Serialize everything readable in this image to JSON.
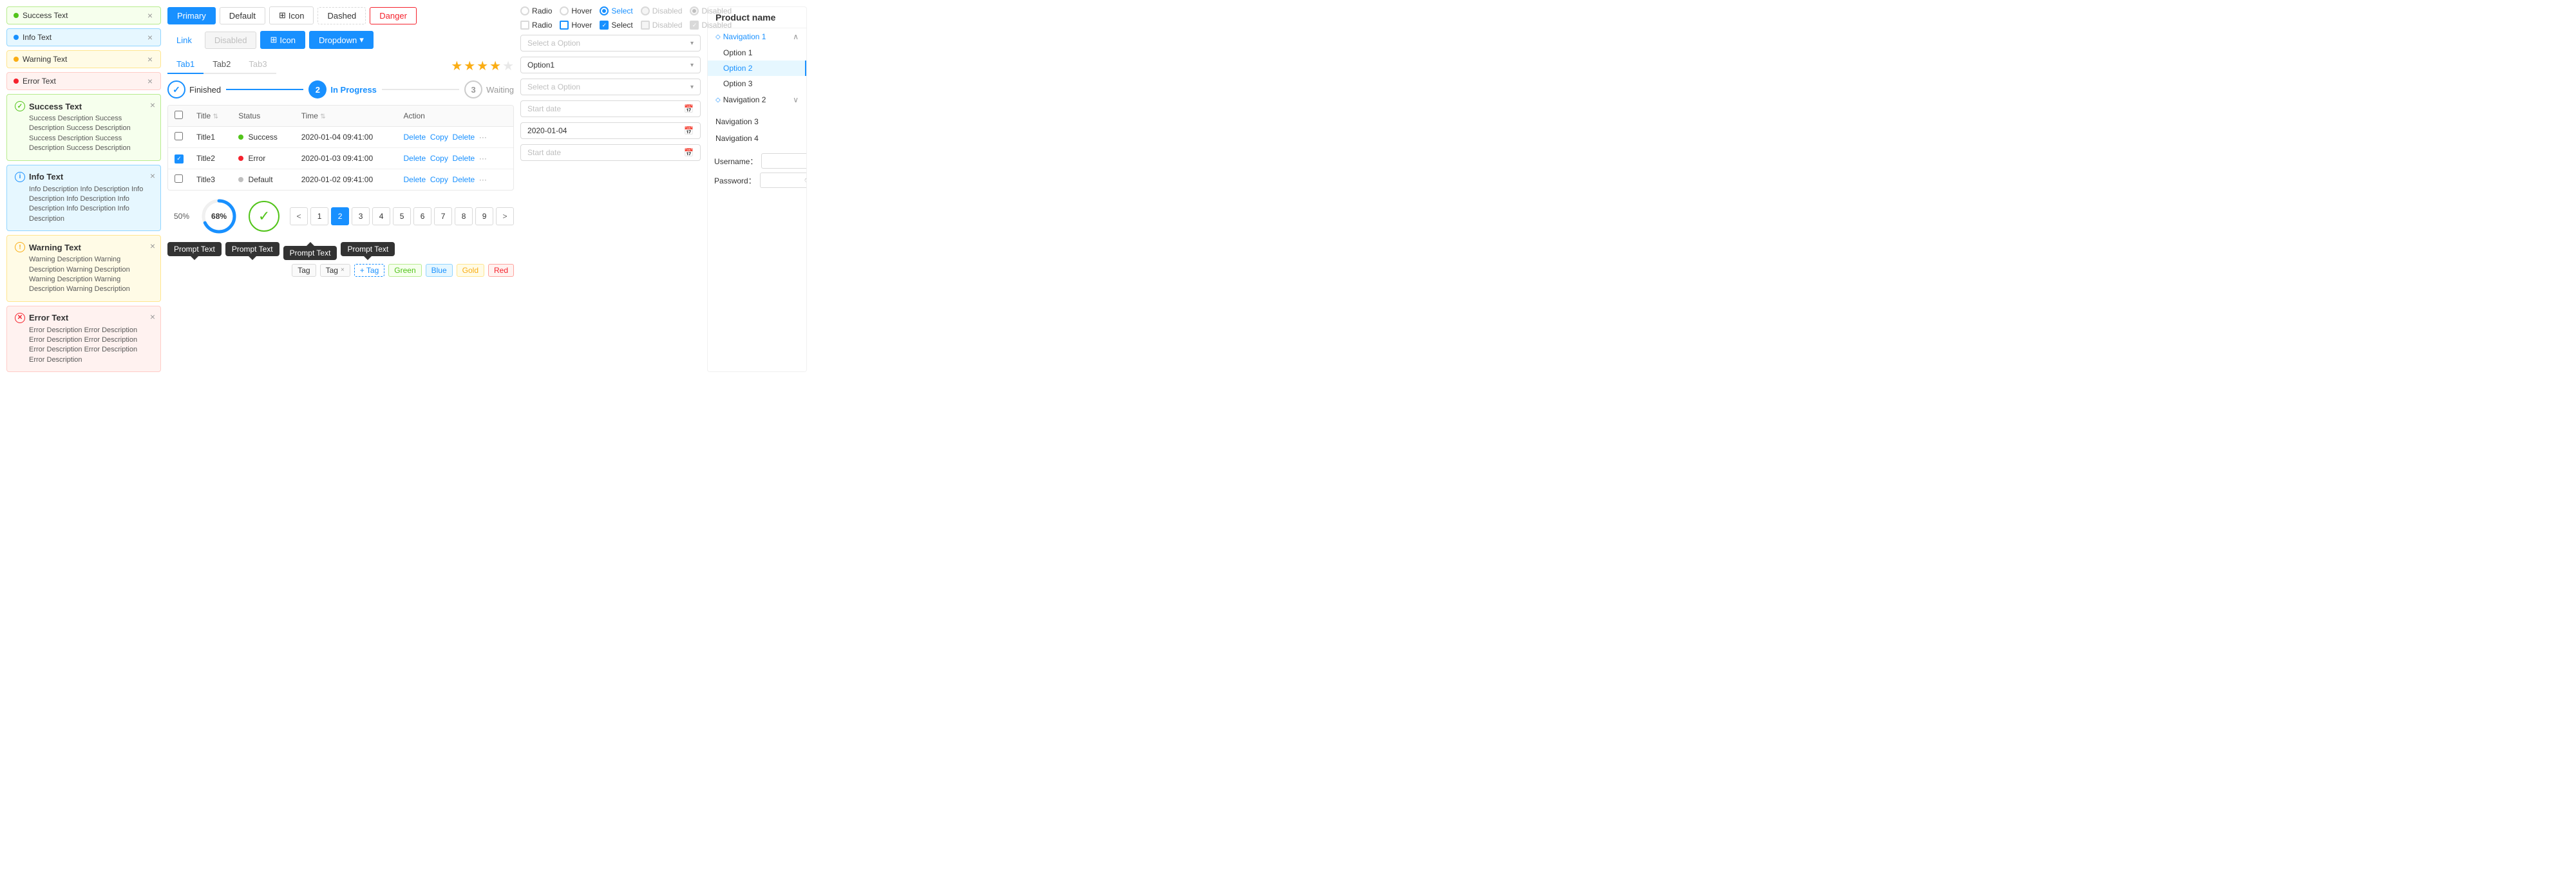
{
  "alerts": {
    "simple": [
      {
        "type": "success",
        "text": "Success Text",
        "dot": "success"
      },
      {
        "type": "info",
        "text": "Info Text",
        "dot": "info"
      },
      {
        "type": "warning",
        "text": "Warning Text",
        "dot": "warning"
      },
      {
        "type": "error",
        "text": "Error Text",
        "dot": "error"
      }
    ],
    "complex": [
      {
        "type": "success",
        "title": "Success Text",
        "desc": "Success Description Success Description Success Description Success Description Success Description Success Description"
      },
      {
        "type": "info",
        "title": "Info Text",
        "desc": "Info Description Info Description Info Description Info Description Info Description Info Description Info Description"
      },
      {
        "type": "warning",
        "title": "Warning Text",
        "desc": "Warning Description Warning Description Warning Description Warning Description Warning Description Warning Description"
      },
      {
        "type": "error",
        "title": "Error Text",
        "desc": "Error Description Error Description Error Description Error Description Error Description Error Description Error Description"
      }
    ]
  },
  "buttons": {
    "row1": [
      {
        "label": "Primary",
        "variant": "primary"
      },
      {
        "label": "Default",
        "variant": "default"
      },
      {
        "label": "Icon",
        "variant": "icon",
        "hasIcon": true
      },
      {
        "label": "Dashed",
        "variant": "dashed"
      },
      {
        "label": "Danger",
        "variant": "danger"
      }
    ],
    "row2": [
      {
        "label": "Link",
        "variant": "link"
      },
      {
        "label": "Disabled",
        "variant": "disabled"
      },
      {
        "label": "Icon",
        "variant": "icon-blue",
        "hasIcon": true
      },
      {
        "label": "Dropdown",
        "variant": "dropdown",
        "hasArrow": true
      }
    ]
  },
  "tabs": {
    "items": [
      {
        "label": "Tab1",
        "active": true
      },
      {
        "label": "Tab2",
        "active": false
      },
      {
        "label": "Tab3",
        "active": false,
        "disabled": true
      }
    ]
  },
  "stars": {
    "filled": 3,
    "half": 1,
    "empty": 1,
    "total": 5
  },
  "steps": [
    {
      "label": "Finished",
      "state": "finished",
      "number": "✓"
    },
    {
      "label": "In Progress",
      "state": "active",
      "number": "2"
    },
    {
      "label": "Waiting",
      "state": "waiting",
      "number": "3"
    }
  ],
  "table": {
    "columns": [
      "Title",
      "Status",
      "Time",
      "Action"
    ],
    "rows": [
      {
        "title": "Title1",
        "status": "Success",
        "statusType": "success",
        "time": "2020-01-04  09:41:00",
        "checked": false
      },
      {
        "title": "Title2",
        "status": "Error",
        "statusType": "error",
        "time": "2020-01-03  09:41:00",
        "checked": true
      },
      {
        "title": "Title3",
        "status": "Default",
        "statusType": "default",
        "time": "2020-01-02  09:41:00",
        "checked": false
      }
    ]
  },
  "progress": {
    "bar_percent": 50,
    "bar_label": "50%",
    "circle_percent": 68,
    "circle_label": "68%"
  },
  "tooltips": [
    {
      "text": "Prompt Text",
      "arrow": "down"
    },
    {
      "text": "Prompt Text",
      "arrow": "down"
    },
    {
      "text": "Prompt Text",
      "arrow": "up"
    },
    {
      "text": "Prompt Text",
      "arrow": "down"
    }
  ],
  "tags": {
    "items": [
      {
        "label": "Tag",
        "color": "default",
        "closable": false
      },
      {
        "label": "Tag",
        "color": "default",
        "closable": true
      }
    ],
    "add_label": "+ Tag",
    "colored": [
      {
        "label": "Green",
        "color": "green"
      },
      {
        "label": "Blue",
        "color": "blue"
      },
      {
        "label": "Gold",
        "color": "gold"
      },
      {
        "label": "Red",
        "color": "red"
      }
    ]
  },
  "pagination": {
    "prev": "<",
    "next": ">",
    "pages": [
      1,
      2,
      3,
      4,
      5,
      6,
      7,
      8,
      9
    ],
    "active": 2
  },
  "controls": {
    "radio_row1": [
      {
        "label": "Radio",
        "state": "unchecked"
      },
      {
        "label": "Hover",
        "state": "unchecked"
      },
      {
        "label": "Select",
        "state": "checked"
      },
      {
        "label": "Disabled",
        "state": "disabled"
      },
      {
        "label": "Disabled",
        "state": "disabled-checked"
      }
    ],
    "checkbox_row2": [
      {
        "label": "Radio",
        "state": "unchecked"
      },
      {
        "label": "Hover",
        "state": "hover"
      },
      {
        "label": "Select",
        "state": "checked"
      },
      {
        "label": "Disabled",
        "state": "disabled"
      },
      {
        "label": "Disabled",
        "state": "disabled-checked"
      }
    ],
    "selects": [
      {
        "placeholder": "Select a Option",
        "value": null
      },
      {
        "placeholder": null,
        "value": "Option1"
      },
      {
        "placeholder": "Select a Option",
        "value": null
      }
    ],
    "dates": [
      {
        "placeholder": "Start date",
        "value": null
      },
      {
        "placeholder": null,
        "value": "2020-01-04"
      },
      {
        "placeholder": "Start date",
        "value": null
      }
    ]
  },
  "navigation": {
    "title": "Product name",
    "groups": [
      {
        "label": "Navigation 1",
        "icon": "diamond",
        "expanded": true,
        "items": [
          "Option 1",
          "Option 2",
          "Option 3"
        ]
      },
      {
        "label": "Navigation 2",
        "icon": "diamond",
        "expanded": false,
        "items": []
      },
      {
        "label": "Navigation 3",
        "type": "plain"
      },
      {
        "label": "Navigation 4",
        "type": "plain"
      }
    ],
    "active_item": "Option 2"
  },
  "form": {
    "username_label": "Username：",
    "username_placeholder": "",
    "password_label": "Password：",
    "password_placeholder": ""
  }
}
